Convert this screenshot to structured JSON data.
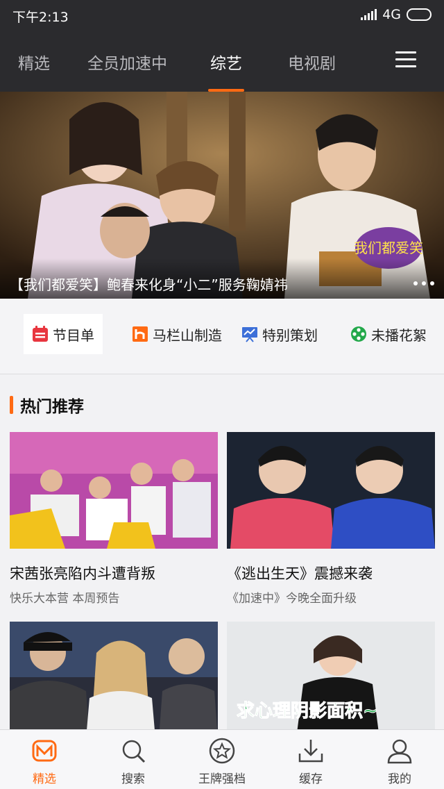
{
  "status_bar": {
    "time": "下午2:13",
    "network": "4G"
  },
  "top_nav": {
    "tabs": [
      {
        "label": "精选"
      },
      {
        "label": "全员加速中"
      },
      {
        "label": "综艺"
      },
      {
        "label": "电视剧"
      }
    ],
    "active_tab": "综艺"
  },
  "banner": {
    "caption": "【我们都爱笑】鲍春来化身“小二”服务鞠婧祎",
    "logo_text": "我们都爱笑"
  },
  "categories": [
    {
      "label": "节目单",
      "icon": "calendar-icon",
      "color": "#e8363f"
    },
    {
      "label": "马栏山制造",
      "icon": "mangguo-h-icon",
      "color": "#ff6a13"
    },
    {
      "label": "特别策划",
      "icon": "presentation-icon",
      "color": "#3c6fd8"
    },
    {
      "label": "未播花絮",
      "icon": "film-reel-icon",
      "color": "#22a84a"
    }
  ],
  "hot_section": {
    "title": "热门推荐",
    "cards": [
      {
        "title": "宋茜张亮陷内斗遭背叛",
        "subtitle": "快乐大本营  本周预告"
      },
      {
        "title": "《逃出生天》震撼来袭",
        "subtitle": "《加速中》今晚全面升级"
      },
      {
        "title": "",
        "subtitle": ""
      },
      {
        "title": "",
        "subtitle": "",
        "overlay_text": "求心理阴影面积~"
      }
    ]
  },
  "bottom_nav": {
    "items": [
      {
        "label": "精选",
        "icon": "mgtv-logo-icon"
      },
      {
        "label": "搜索",
        "icon": "search-icon"
      },
      {
        "label": "王牌强档",
        "icon": "star-icon"
      },
      {
        "label": "缓存",
        "icon": "download-icon"
      },
      {
        "label": "我的",
        "icon": "user-icon"
      }
    ],
    "active": "精选"
  },
  "colors": {
    "accent": "#ff6a13",
    "header_bg": "#2b2b2e",
    "page_bg": "#f2f2f4"
  }
}
